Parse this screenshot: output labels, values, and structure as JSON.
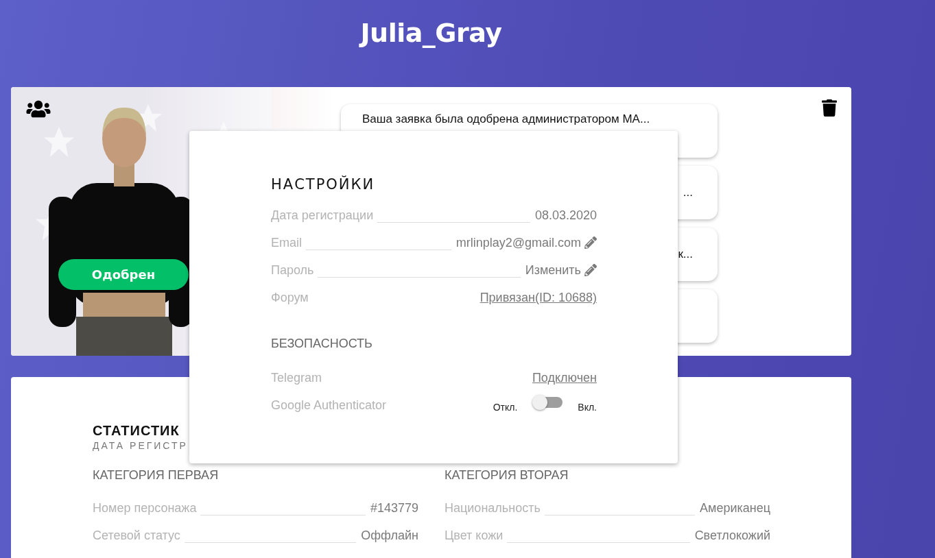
{
  "page_title": "Julia_Gray",
  "profile": {
    "status_badge": "Одобрен",
    "notifications": [
      {
        "kind": "message",
        "text": "Ваша заявка была одобрена администратором МА..."
      },
      {
        "kind": "message",
        "text": "..."
      },
      {
        "kind": "message",
        "text": "к..."
      },
      {
        "kind": "empty"
      }
    ]
  },
  "settings": {
    "title": "НАСТРОЙКИ",
    "rows": [
      {
        "kind": "text",
        "label": "Дата регистрации",
        "value": "08.03.2020"
      },
      {
        "kind": "edit",
        "label": "Email",
        "value": "mrlinplay2@gmail.com"
      },
      {
        "kind": "edit",
        "label": "Пароль",
        "value": "Изменить"
      },
      {
        "kind": "link",
        "label": "Форум",
        "value": "Привязан(ID: 10688)"
      }
    ],
    "security": {
      "heading": "БЕЗОПАСНОСТЬ",
      "rows": [
        {
          "kind": "link",
          "label": "Telegram",
          "value": "Подключен"
        },
        {
          "kind": "toggle",
          "label": "Google Authenticator",
          "off_label": "Откл.",
          "on_label": "Вкл.",
          "on": false
        }
      ]
    }
  },
  "statistics": {
    "title": "СТАТИСТИК",
    "subtitle": "ДАТА РЕГИСТР",
    "columns": [
      {
        "heading": "КАТЕГОРИЯ ПЕРВАЯ",
        "rows": [
          {
            "label": "Номер персонажа",
            "value": "#143779"
          },
          {
            "label": "Сетевой статус",
            "value": "Оффлайн"
          }
        ]
      },
      {
        "heading": "КАТЕГОРИЯ ВТОРАЯ",
        "rows": [
          {
            "label": "Национальность",
            "value": "Американец"
          },
          {
            "label": "Цвет кожи",
            "value": "Светлокожий"
          }
        ]
      }
    ]
  }
}
